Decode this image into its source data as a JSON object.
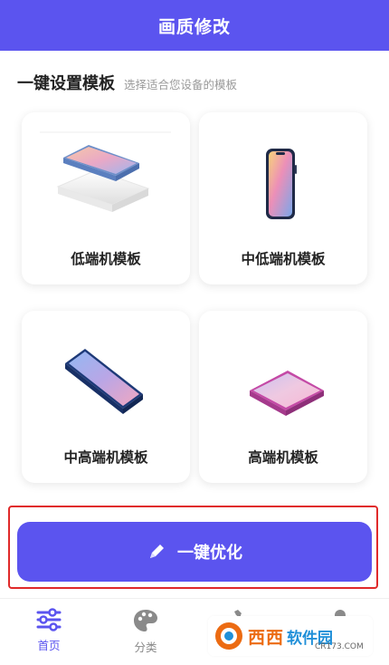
{
  "header": {
    "title": "画质修改"
  },
  "section": {
    "title": "一键设置模板",
    "subtitle": "选择适合您设备的模板"
  },
  "templates": [
    {
      "label": "低端机模板",
      "icon": "phone-on-stand-icon"
    },
    {
      "label": "中低端机模板",
      "icon": "phone-upright-icon"
    },
    {
      "label": "中高端机模板",
      "icon": "phone-tilted-icon"
    },
    {
      "label": "高端机模板",
      "icon": "phone-flat-icon"
    }
  ],
  "optimize": {
    "label": "一键优化",
    "icon": "pen-icon"
  },
  "tabs": [
    {
      "label": "首页",
      "icon": "sliders-icon",
      "active": true
    },
    {
      "label": "分类",
      "icon": "palette-icon",
      "active": false
    },
    {
      "label": "",
      "icon": "tools-icon",
      "active": false
    },
    {
      "label": "",
      "icon": "profile-icon",
      "active": false
    }
  ],
  "watermark": {
    "brand": "西西",
    "suffix": "软件园",
    "url": "CR173.COM"
  },
  "colors": {
    "primary": "#5b54ef",
    "highlight_border": "#e02a2a",
    "watermark_orange": "#ec6b12",
    "watermark_blue": "#1f8fd8"
  }
}
